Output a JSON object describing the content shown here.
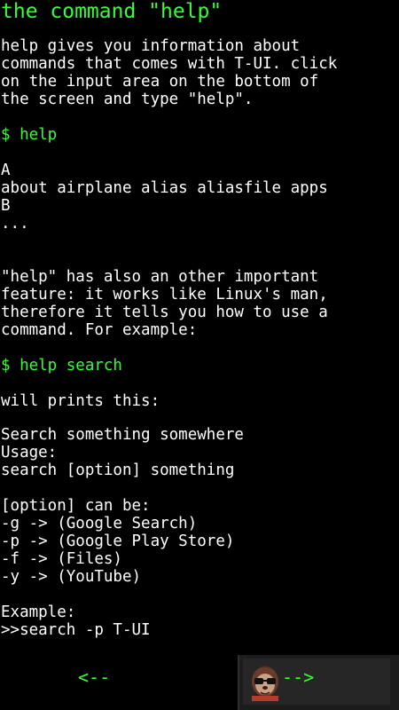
{
  "page": {
    "title": "the command \"help\"",
    "intro_lines": [
      "help gives you information about",
      "commands that comes with T-UI. click",
      "on the input area on the bottom of",
      "the screen and type \"help\"."
    ],
    "command1": "$ help",
    "output1_lines": [
      "A",
      "about airplane alias aliasfile apps",
      "B",
      "..."
    ],
    "feature_lines": [
      "\"help\" has also an other important",
      "feature: it works like Linux's man,",
      "therefore it tells you how to use a",
      "command. For example:"
    ],
    "command2": "$ help search",
    "will_prints": "will prints this:",
    "usage_lines": [
      "Search something somewhere",
      "Usage:",
      "search [option] something"
    ],
    "option_lines": [
      "[option] can be:",
      "-g -> (Google Search)",
      "-p -> (Google Play Store)",
      "-f -> (Files)",
      "-y -> (YouTube)"
    ],
    "example_lines": [
      "Example:",
      ">>search -p T-UI"
    ]
  },
  "nav": {
    "prev_label": "<--",
    "next_label": "-->"
  },
  "colors": {
    "background": "#000000",
    "text": "#ffffff",
    "accent": "#33ff33"
  },
  "icons": {
    "avatar": "sloth-with-sunglasses-icon"
  }
}
